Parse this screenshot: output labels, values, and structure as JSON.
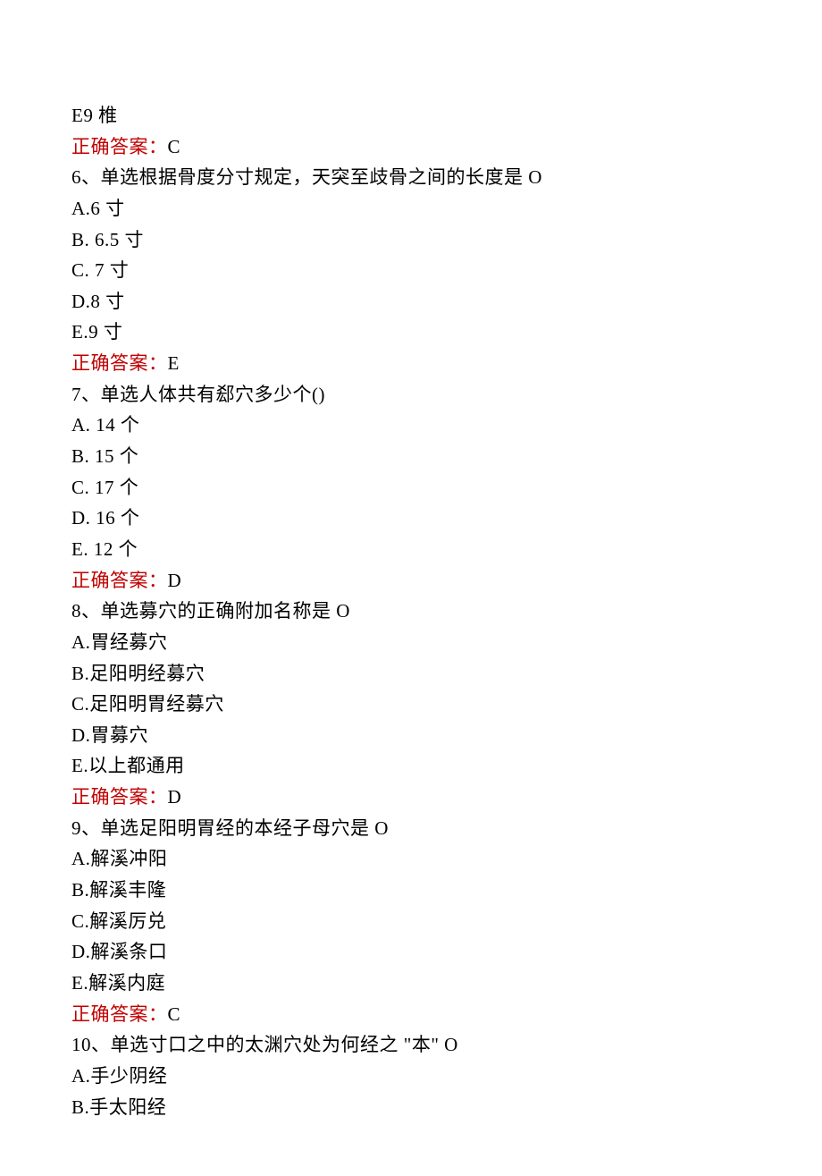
{
  "q5": {
    "optionE": "E9 椎",
    "answerLabel": "正确答案：",
    "answerValue": "C"
  },
  "q6": {
    "stem": "6、单选根据骨度分寸规定，天突至歧骨之间的长度是 O",
    "optionA": "A.6 寸",
    "optionB": "B. 6.5 寸",
    "optionC": "C. 7 寸",
    "optionD": "D.8 寸",
    "optionE": "E.9 寸",
    "answerLabel": "正确答案：",
    "answerValue": "E"
  },
  "q7": {
    "stem": "7、单选人体共有郄穴多少个()",
    "optionA": "A. 14 个",
    "optionB": "B. 15 个",
    "optionC": "C. 17 个",
    "optionD": "D. 16 个",
    "optionE": "E. 12 个",
    "answerLabel": "正确答案：",
    "answerValue": "D"
  },
  "q8": {
    "stem": "8、单选募穴的正确附加名称是 O",
    "optionA": "A.胃经募穴",
    "optionB": "B.足阳明经募穴",
    "optionC": "C.足阳明胃经募穴",
    "optionD": "D.胃募穴",
    "optionE": "E.以上都通用",
    "answerLabel": "正确答案：",
    "answerValue": "D"
  },
  "q9": {
    "stem": "9、单选足阳明胃经的本经子母穴是 O",
    "optionA": "A.解溪冲阳",
    "optionB": "B.解溪丰隆",
    "optionC": "C.解溪厉兑",
    "optionD": "D.解溪条口",
    "optionE": "E.解溪内庭",
    "answerLabel": "正确答案：",
    "answerValue": "C"
  },
  "q10": {
    "stem": "10、单选寸口之中的太渊穴处为何经之 \"本\" O",
    "optionA": "A.手少阴经",
    "optionB": "B.手太阳经"
  }
}
